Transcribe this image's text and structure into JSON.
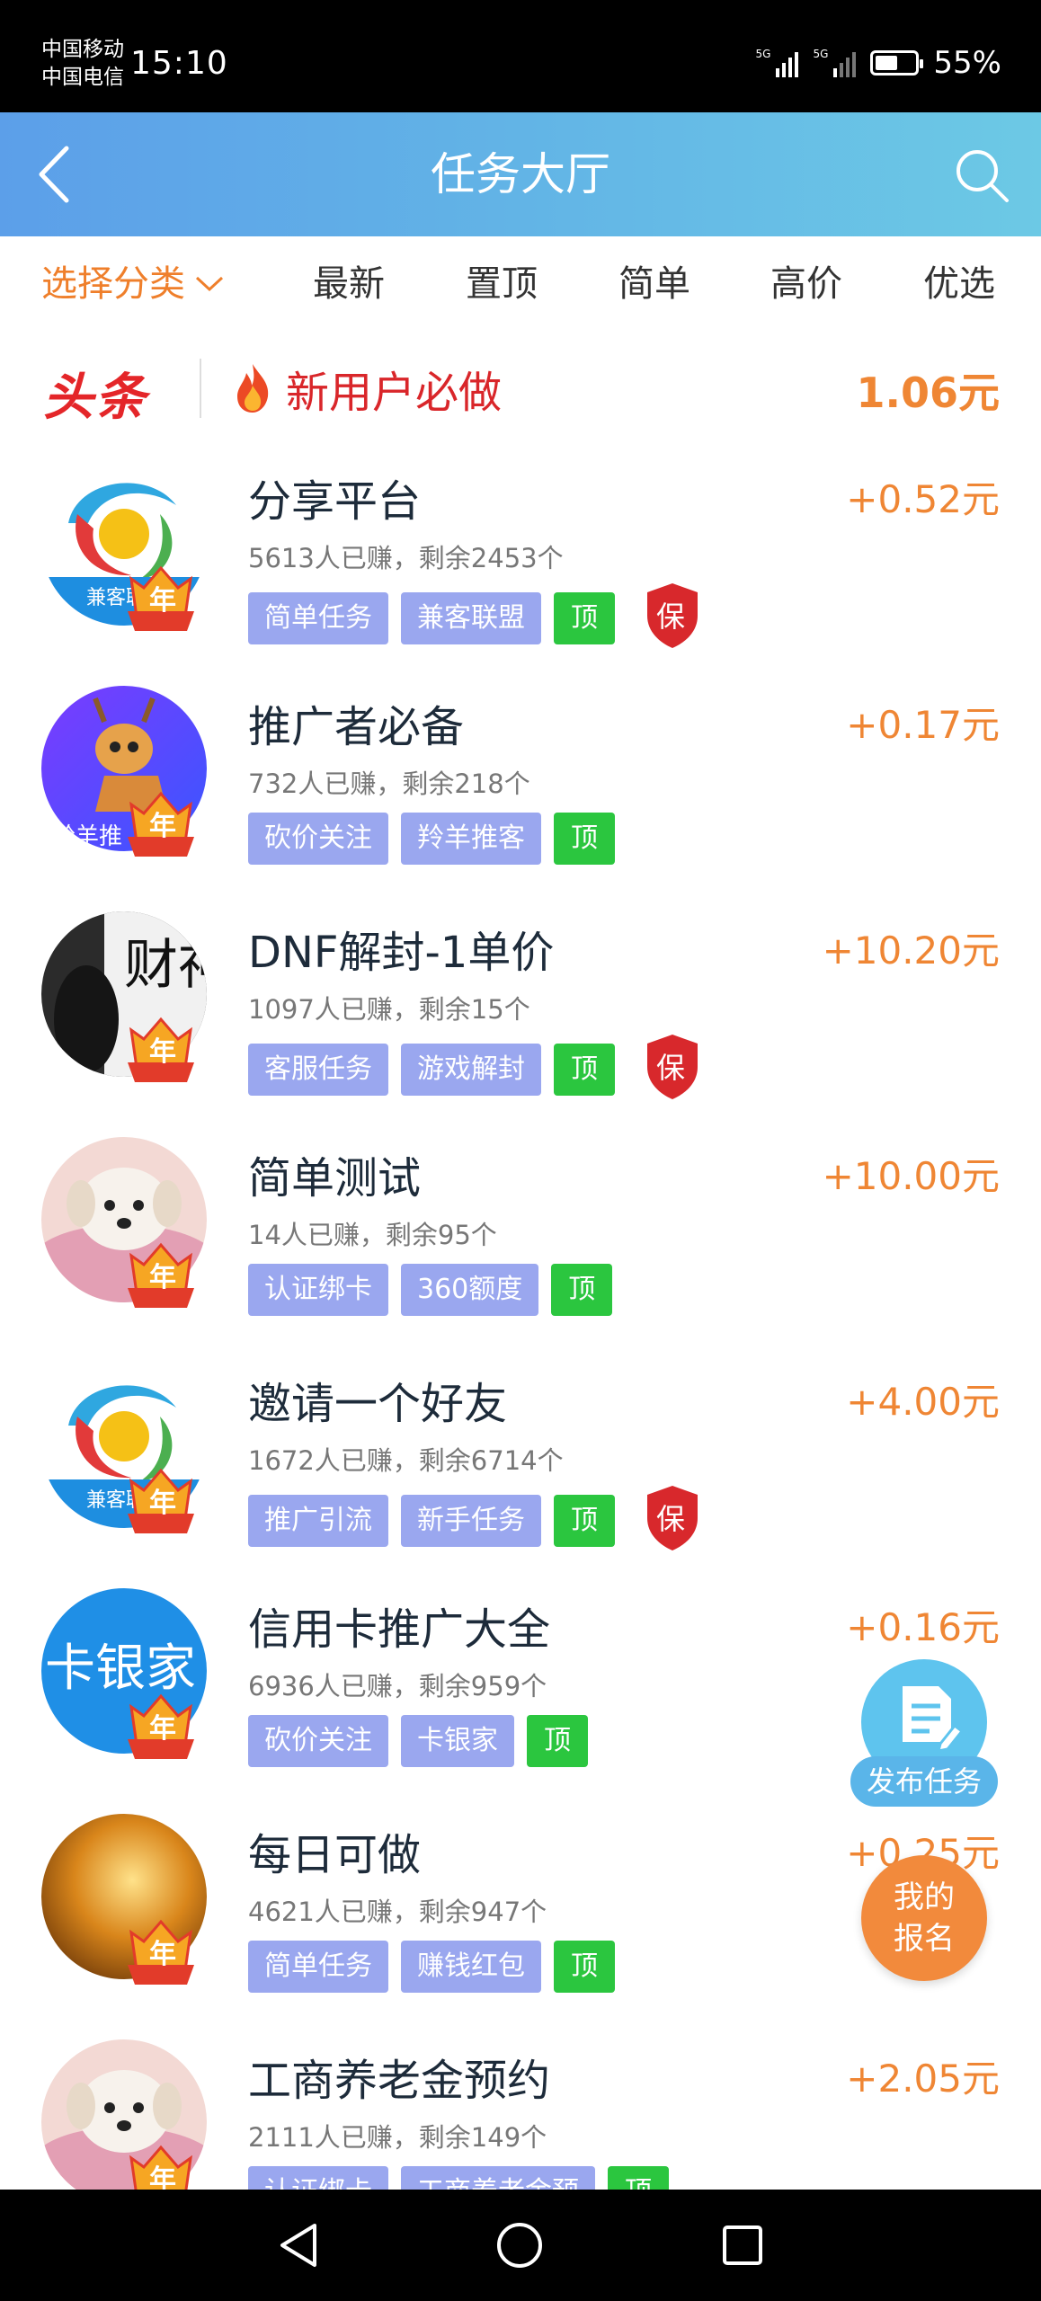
{
  "status_bar": {
    "carrier1": "中国移动",
    "carrier2": "中国电信",
    "time": "15:10",
    "battery": "55%"
  },
  "header": {
    "title": "任务大厅"
  },
  "filters": {
    "category_label": "选择分类",
    "tabs": [
      "最新",
      "置顶",
      "简单",
      "高价",
      "优选"
    ]
  },
  "headline": {
    "brand": "头条",
    "text": "新用户必做",
    "price": "1.06元"
  },
  "tasks": [
    {
      "title": "分享平台",
      "stats": "5613人已赚，剩余2453个",
      "tags": [
        "简单任务",
        "兼客联盟"
      ],
      "top_label": "顶",
      "guarantee": "保",
      "reward": "+0.52元",
      "avatar": "logo"
    },
    {
      "title": "推广者必备",
      "stats": "732人已赚，剩余218个",
      "tags": [
        "砍价关注",
        "羚羊推客"
      ],
      "top_label": "顶",
      "guarantee": "",
      "reward": "+0.17元",
      "avatar": "deer"
    },
    {
      "title": "DNF解封-1单价",
      "stats": "1097人已赚，剩余15个",
      "tags": [
        "客服任务",
        "游戏解封"
      ],
      "top_label": "顶",
      "guarantee": "保",
      "reward": "+10.20元",
      "avatar": "dark"
    },
    {
      "title": "简单测试",
      "stats": "14人已赚，剩余95个",
      "tags": [
        "认证绑卡",
        "360额度"
      ],
      "top_label": "顶",
      "guarantee": "",
      "reward": "+10.00元",
      "avatar": "dog"
    },
    {
      "title": "邀请一个好友",
      "stats": "1672人已赚，剩余6714个",
      "tags": [
        "推广引流",
        "新手任务"
      ],
      "top_label": "顶",
      "guarantee": "保",
      "reward": "+4.00元",
      "avatar": "logo"
    },
    {
      "title": "信用卡推广大全",
      "stats": "6936人已赚，剩余959个",
      "tags": [
        "砍价关注",
        "卡银家"
      ],
      "top_label": "顶",
      "guarantee": "",
      "reward": "+0.16元",
      "avatar": "card"
    },
    {
      "title": "每日可做",
      "stats": "4621人已赚，剩余947个",
      "tags": [
        "简单任务",
        "赚钱红包"
      ],
      "top_label": "顶",
      "guarantee": "",
      "reward": "+0.25元",
      "avatar": "warm"
    },
    {
      "title": "工商养老金预约",
      "stats": "2111人已赚，剩余149个",
      "tags": [
        "认证绑卡",
        "工商养老金预"
      ],
      "top_label": "顶",
      "guarantee": "",
      "reward": "+2.05元",
      "avatar": "dog"
    }
  ],
  "avatar_texts": {
    "logo_caption": "兼客联",
    "card_text": "卡银家",
    "deer_caption": "羚羊推",
    "dark_text": "财神",
    "year_badge": "年"
  },
  "fab": {
    "publish_label": "发布任务",
    "signup_line1": "我的",
    "signup_line2": "报名"
  },
  "colors": {
    "accent_orange": "#ef8634",
    "tag_purple": "#9aa7ef",
    "tag_green": "#2bc63f",
    "header_blue": "#5c9fe9",
    "headline_red": "#d9262a"
  }
}
